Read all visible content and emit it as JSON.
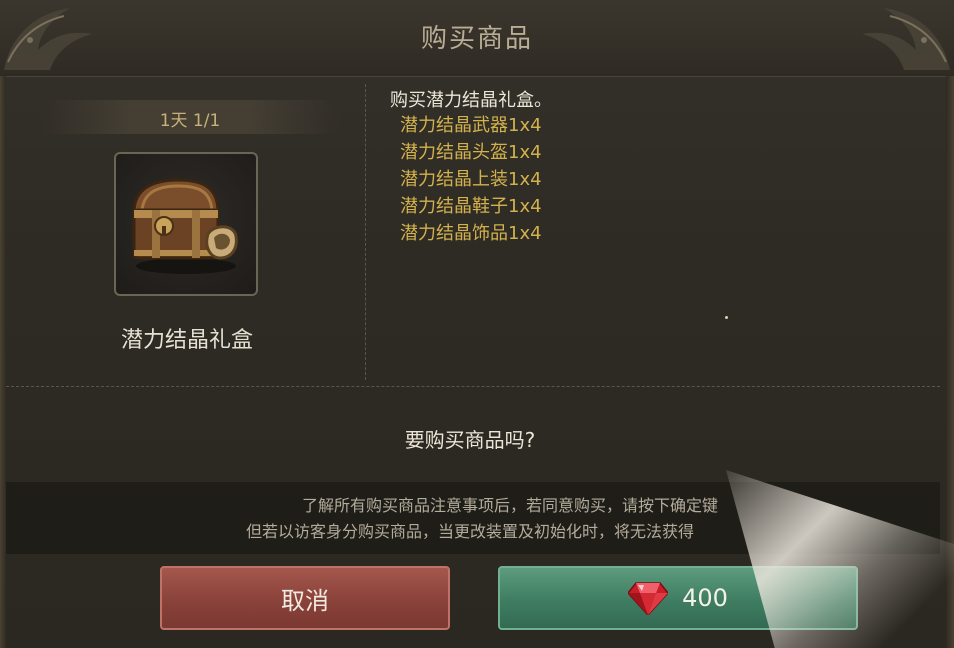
{
  "dialog": {
    "title": "购买商品"
  },
  "item": {
    "limit": "1天 1/1",
    "icon": "treasure-chest-icon",
    "name": "潜力结晶礼盒"
  },
  "description": {
    "heading": "购买潜力结晶礼盒。",
    "contents": [
      "潜力结晶武器1x4",
      "潜力结晶头盔1x4",
      "潜力结晶上装1x4",
      "潜力结晶鞋子1x4",
      "潜力结晶饰品1x4"
    ]
  },
  "confirm_question": "要购买商品吗?",
  "notice": {
    "line1": "了解所有购买商品注意事项后，若同意购买，请按下确定键",
    "line2": "但若以访客身分购买商品，当更改装置及初始化时，将无法获得"
  },
  "buttons": {
    "cancel_label": "取消",
    "confirm_price": "400",
    "currency_icon": "ruby-icon"
  },
  "colors": {
    "cancel": "#8a423a",
    "confirm": "#3f7d62",
    "contents_text": "#d2b24d",
    "limit_text": "#c9b27a"
  }
}
